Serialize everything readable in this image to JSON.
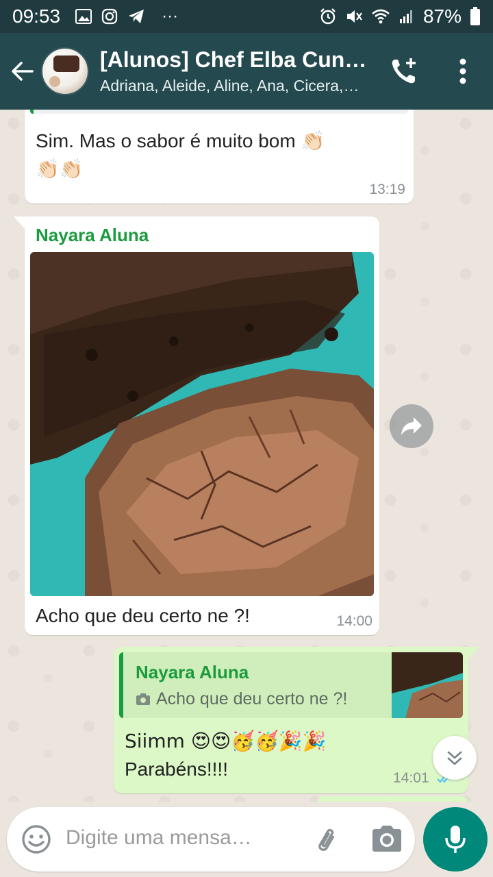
{
  "status_bar": {
    "time": "09:53",
    "icons_left": [
      "image-icon",
      "instagram-icon",
      "telegram-icon",
      "more-dots-icon"
    ],
    "icons_right": [
      "alarm-icon",
      "mute-icon",
      "wifi-icon",
      "signal-icon"
    ],
    "battery": "87%"
  },
  "header": {
    "title": "[Alunos] Chef Elba Cun…",
    "subtitle": "Adriana, Aleide, Aline, Ana, Cicera,…"
  },
  "messages": [
    {
      "direction": "in",
      "text_line1": "Sim. Mas o sabor é muito bom 👏🏻",
      "text_line2": "👏🏻👏🏻",
      "time": "13:19"
    },
    {
      "direction": "in",
      "sender": "Nayara Aluna",
      "has_image": true,
      "caption": "Acho que deu certo ne ?!",
      "time": "14:00"
    },
    {
      "direction": "out",
      "quote": {
        "sender": "Nayara Aluna",
        "text": "Acho que deu certo ne ?!"
      },
      "text_line1": "Siimm 😍😍🥳🥳🎉🎉",
      "text_line2": "Parabéns!!!!",
      "time": "14:01",
      "status": "read"
    }
  ],
  "input": {
    "placeholder": "Digite uma mensa…"
  },
  "colors": {
    "header": "#24494f",
    "status_bar": "#1f3b40",
    "sender_name": "#1a9b3d",
    "outgoing_bubble": "#dcf8c6",
    "mic_button": "#00897b",
    "read_ticks": "#4fc3f7"
  }
}
